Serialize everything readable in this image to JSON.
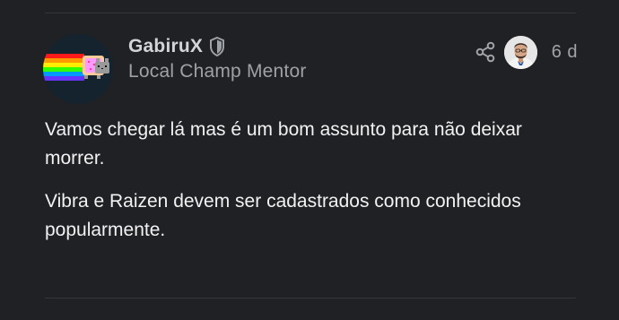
{
  "post": {
    "username": "GabiruX",
    "user_title": "Local Champ Mentor",
    "date": "6 d",
    "paragraphs": [
      "Vamos chegar lá mas é um bom assunto para não deixar morrer.",
      "Vibra e Raizen devem ser cadastrados como conhecidos popularmente."
    ]
  },
  "icons": {
    "badge": "shield-icon",
    "share": "share-icon",
    "avatar": "nyan-cat-avatar"
  },
  "colors": {
    "background": "#202124",
    "username": "#d2d4d7",
    "muted": "#9ea1a6",
    "divider": "#34363b"
  }
}
